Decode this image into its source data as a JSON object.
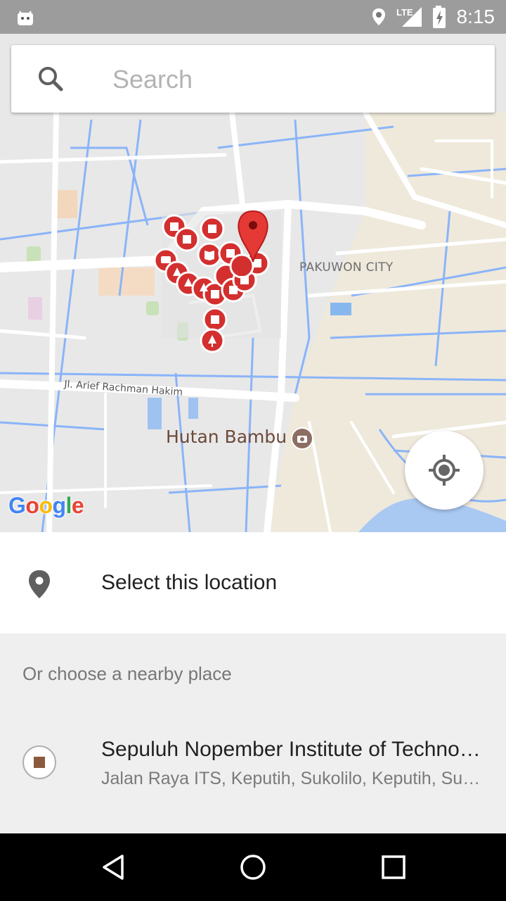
{
  "status_bar": {
    "time": "8:15",
    "network": "LTE",
    "icons": [
      "android-icon",
      "location-icon",
      "signal-icon",
      "battery-charging-icon"
    ]
  },
  "search": {
    "placeholder": "Search",
    "icon": "search-icon"
  },
  "map": {
    "labels": {
      "district": "PAKUWON CITY",
      "street": "Jl. Arief Rachman Hakim",
      "poi": "Hutan Bambu"
    },
    "brand": {
      "text": "Google",
      "letter_colors": [
        "#4285F4",
        "#EA4335",
        "#FBBC05",
        "#4285F4",
        "#34A853",
        "#EA4335"
      ]
    },
    "locate_button_icon": "my-location-icon",
    "marker_color": "#d32f2f"
  },
  "select_location": {
    "label": "Select this location",
    "icon": "place-icon"
  },
  "nearby": {
    "header": "Or choose a nearby place",
    "places": [
      {
        "name": "Sepuluh Nopember Institute of Technology",
        "address": "Jalan Raya ITS, Keputih, Sukolilo, Keputih, Surabaya",
        "icon": "university-icon"
      }
    ]
  },
  "nav_bar": {
    "buttons": [
      "back-icon",
      "home-icon",
      "recents-icon"
    ]
  }
}
